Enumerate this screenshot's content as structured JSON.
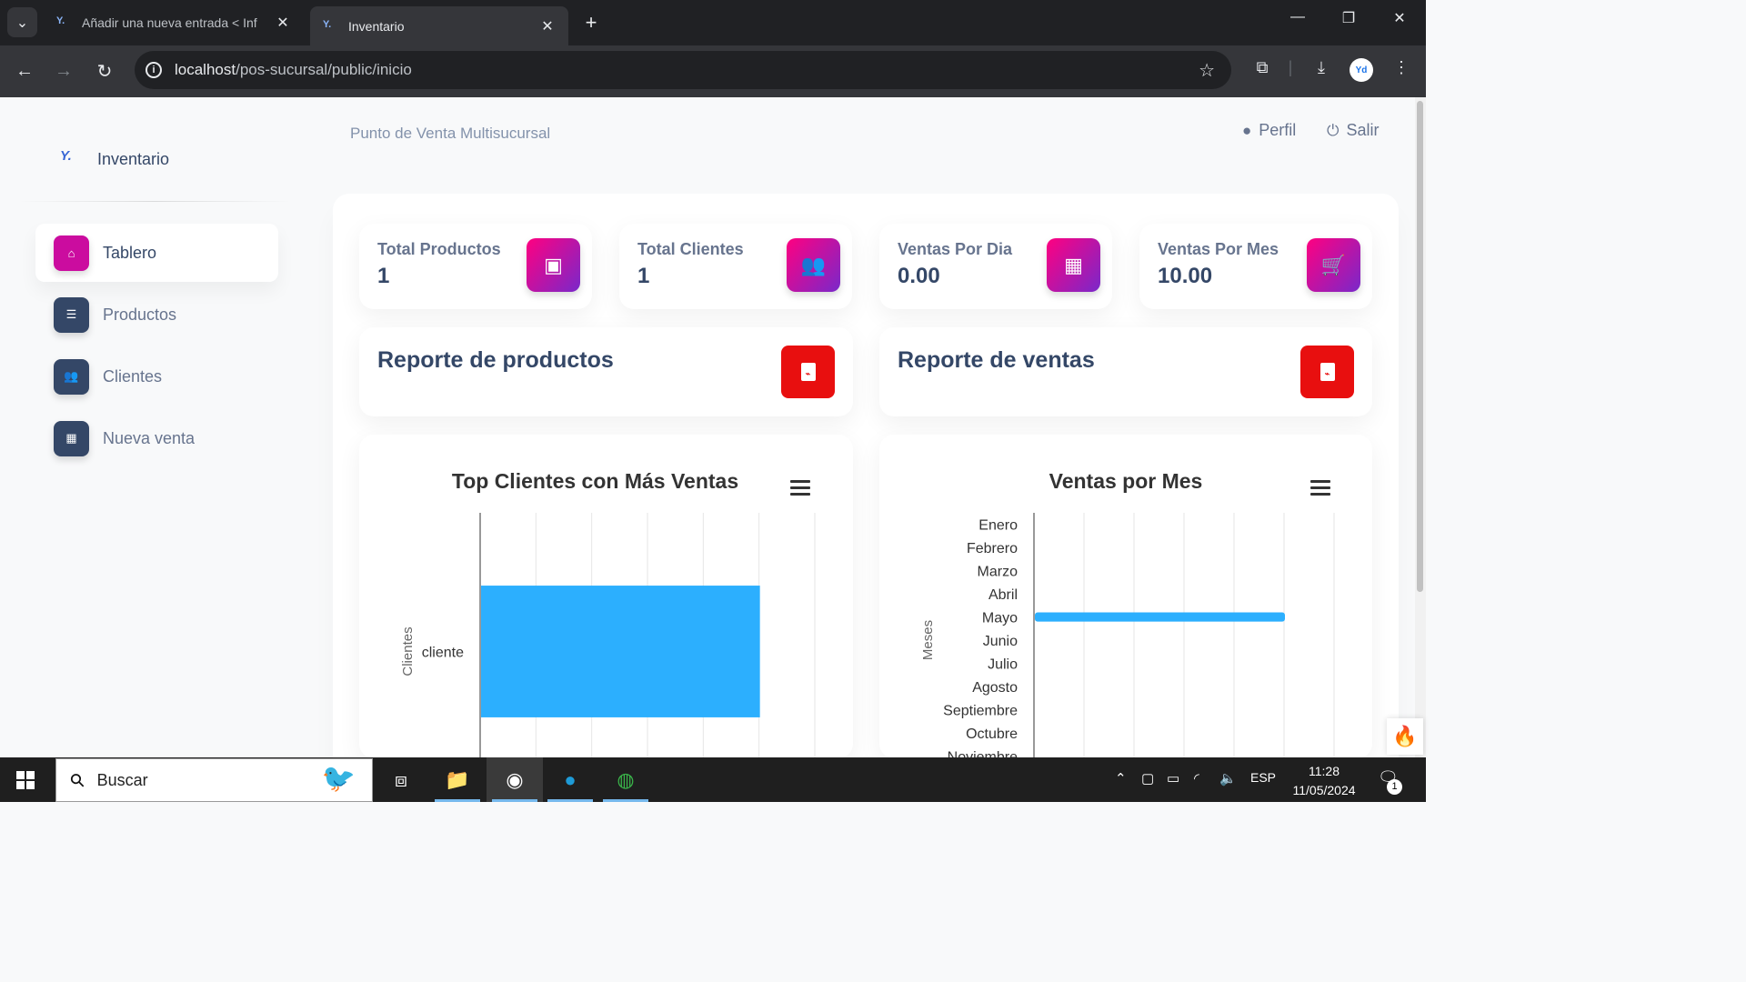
{
  "browser": {
    "tabs": [
      {
        "title": "Añadir una nueva entrada < Inf",
        "favicon": "Y."
      },
      {
        "title": "Inventario",
        "favicon": "Y."
      }
    ],
    "new_tab": "+",
    "url_host": "localhost",
    "url_path": "/pos-sucursal/public/inicio",
    "avatar_text": "Yd"
  },
  "sidebar": {
    "brand_logo": "Y.",
    "brand_name": "Inventario",
    "items": [
      {
        "label": "Tablero",
        "icon": "home-icon",
        "active": true
      },
      {
        "label": "Productos",
        "icon": "list-icon",
        "active": false
      },
      {
        "label": "Clientes",
        "icon": "users-icon",
        "active": false
      },
      {
        "label": "Nueva venta",
        "icon": "calendar-icon",
        "active": false
      }
    ]
  },
  "header": {
    "subtitle": "Punto de Venta Multisucursal",
    "profile_label": "Perfil",
    "logout_label": "Salir"
  },
  "stats": [
    {
      "label": "Total Productos",
      "value": "1",
      "icon": "box-icon"
    },
    {
      "label": "Total Clientes",
      "value": "1",
      "icon": "users-icon"
    },
    {
      "label": "Ventas Por Dia",
      "value": "0.00",
      "icon": "calendar-icon"
    },
    {
      "label": "Ventas Por Mes",
      "value": "10.00",
      "icon": "cart-icon"
    }
  ],
  "reports": [
    {
      "title": "Reporte de productos",
      "icon": "pdf-icon"
    },
    {
      "title": "Reporte de ventas",
      "icon": "pdf-icon"
    }
  ],
  "colors": {
    "accent_gradient_start": "#7928ca",
    "accent_gradient_end": "#ff0080",
    "pdf_red": "#e80f0f",
    "bar_blue": "#2caffe",
    "text_dark": "#344767"
  },
  "chart_data": [
    {
      "type": "bar",
      "orientation": "horizontal",
      "title": "Top Clientes con Más Ventas",
      "ylabel": "Clientes",
      "categories": [
        "cliente"
      ],
      "values": [
        5
      ],
      "xlim": [
        0,
        6
      ],
      "grid": true
    },
    {
      "type": "bar",
      "orientation": "horizontal",
      "title": "Ventas por Mes",
      "ylabel": "Meses",
      "categories": [
        "Enero",
        "Febrero",
        "Marzo",
        "Abril",
        "Mayo",
        "Junio",
        "Julio",
        "Agosto",
        "Septiembre",
        "Octubre",
        "Noviembre"
      ],
      "values": [
        0,
        0,
        0,
        0,
        10,
        0,
        0,
        0,
        0,
        0,
        0
      ],
      "xlim": [
        0,
        12
      ],
      "grid": true
    }
  ],
  "taskbar": {
    "search_placeholder": "Buscar",
    "language": "ESP",
    "time": "11:28",
    "date": "11/05/2024",
    "notification_count": "1"
  }
}
